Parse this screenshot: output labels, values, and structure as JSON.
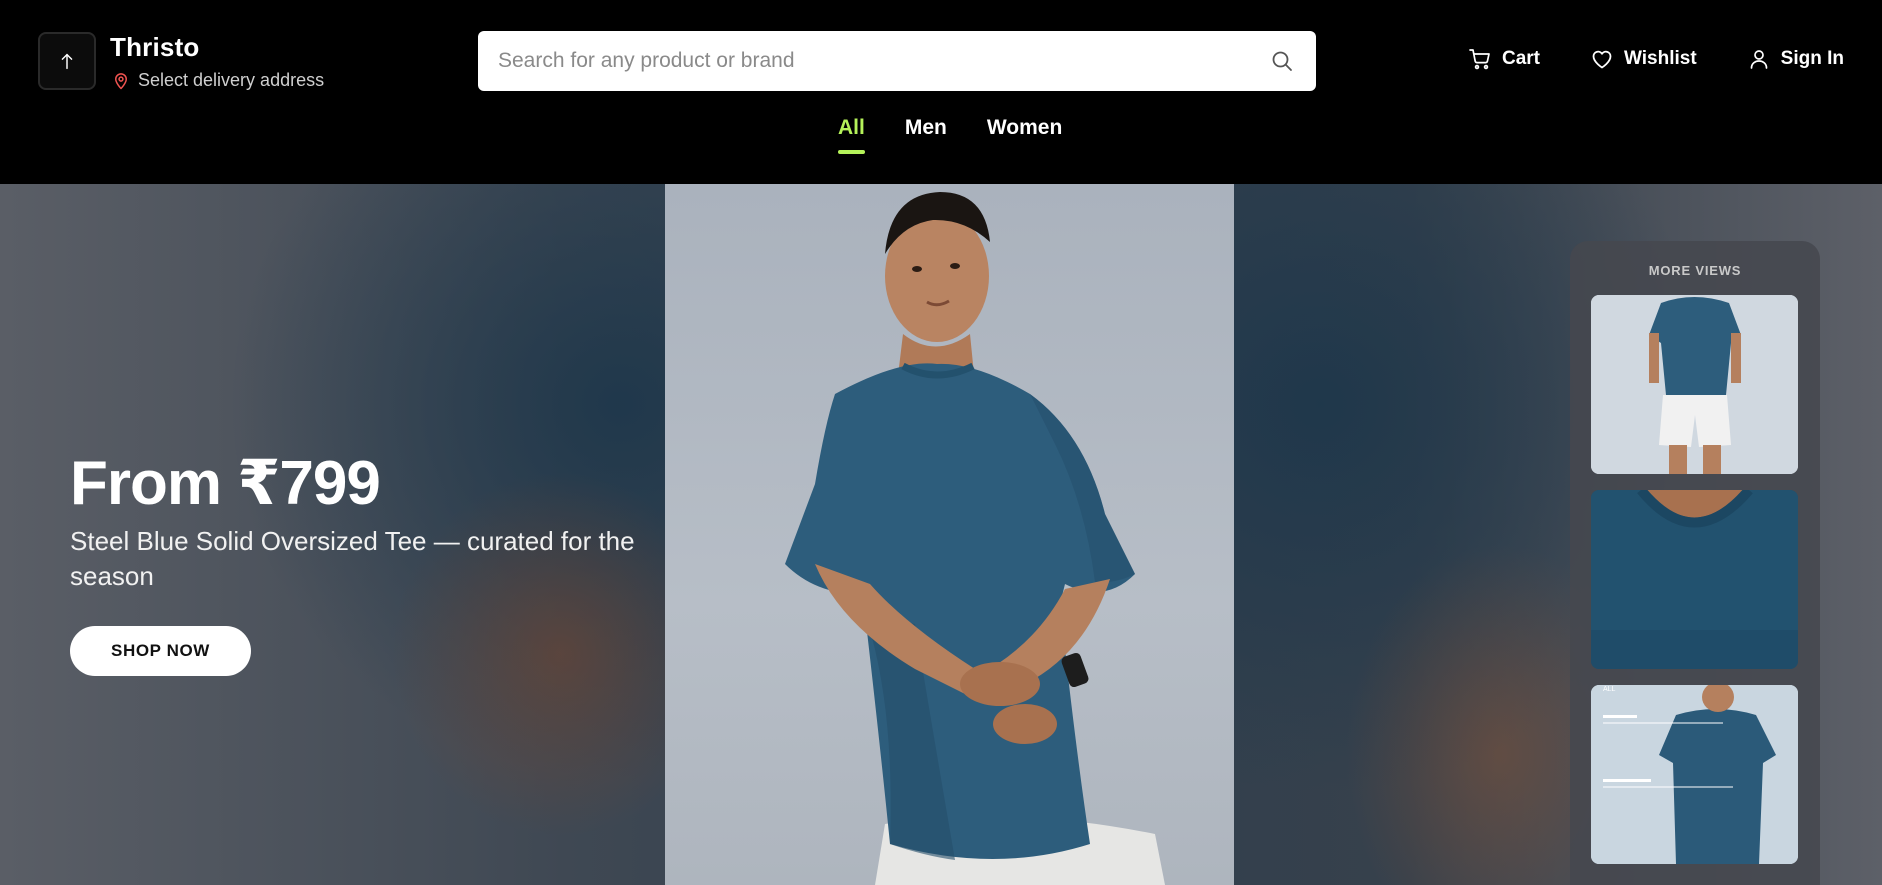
{
  "header": {
    "brand": "Thristo",
    "logo_icon": "upload-arrow-icon",
    "delivery": {
      "icon": "map-pin-icon",
      "label": "Select delivery address",
      "icon_color": "#ef5350"
    },
    "search": {
      "placeholder": "Search for any product or brand",
      "value": "",
      "icon": "search-icon"
    },
    "actions": [
      {
        "label": "Cart",
        "icon": "cart-icon"
      },
      {
        "label": "Wishlist",
        "icon": "heart-icon"
      },
      {
        "label": "Sign In",
        "icon": "user-icon"
      }
    ],
    "nav_tabs": [
      {
        "label": "All",
        "active": true
      },
      {
        "label": "Men",
        "active": false
      },
      {
        "label": "Women",
        "active": false
      }
    ],
    "accent_color": "#b5f25a"
  },
  "hero": {
    "title": "From ₹799",
    "subtitle": "Steel Blue Solid Oversized Tee — curated for the season",
    "cta_label": "SHOP NOW",
    "more_views": {
      "title": "MORE VIEWS",
      "thumbnails": [
        "view-front-full",
        "view-neck-closeup",
        "view-size-guide"
      ],
      "size_guide_text": "ALL"
    }
  }
}
